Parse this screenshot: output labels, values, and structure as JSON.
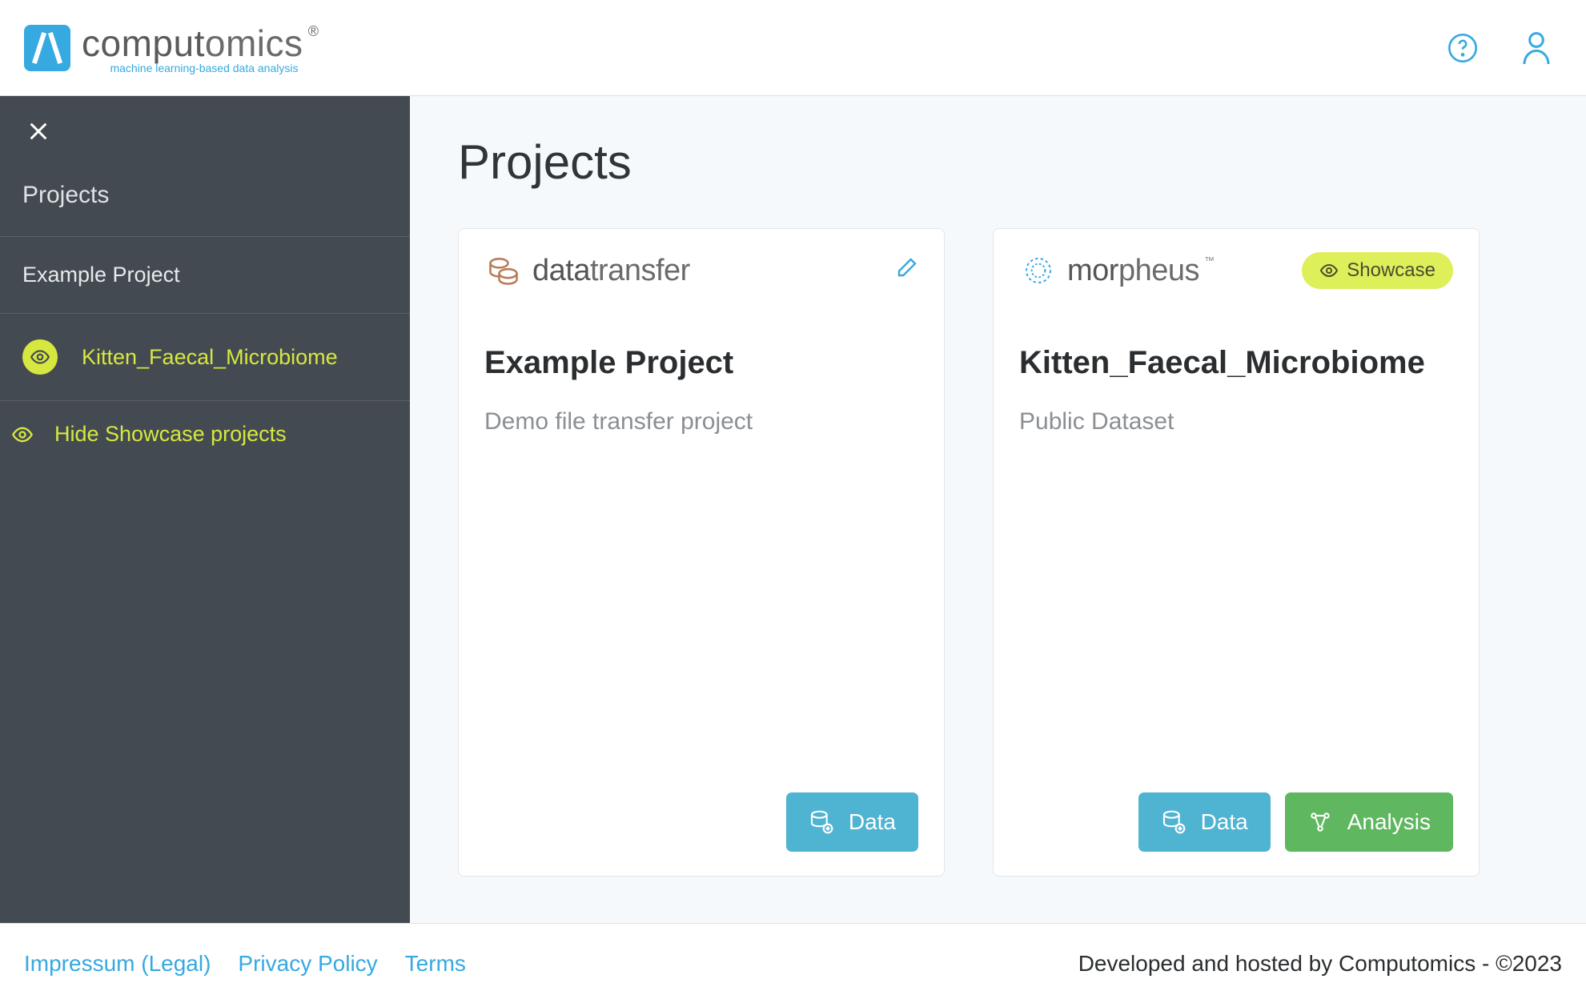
{
  "header": {
    "brand_main": "comput",
    "brand_suffix": "omics",
    "brand_reg": "®",
    "brand_tagline": "machine learning-based data analysis"
  },
  "sidebar": {
    "section_title": "Projects",
    "items": [
      {
        "label": "Example Project",
        "active": false
      },
      {
        "label": "Kitten_Faecal_Microbiome",
        "active": true
      }
    ],
    "toggle_label": "Hide Showcase projects"
  },
  "main": {
    "title": "Projects",
    "cards": [
      {
        "brand_bold": "data",
        "brand_light": "transfer",
        "showcase": false,
        "title": "Example Project",
        "desc": "Demo file transfer project",
        "data_btn": "Data",
        "analysis_btn": null
      },
      {
        "brand_bold": "mor",
        "brand_light": "pheus",
        "brand_tm": "™",
        "showcase": true,
        "showcase_label": "Showcase",
        "title": "Kitten_Faecal_Microbiome",
        "desc": "Public Dataset",
        "data_btn": "Data",
        "analysis_btn": "Analysis"
      }
    ]
  },
  "footer": {
    "links": [
      "Impressum (Legal)",
      "Privacy Policy",
      "Terms"
    ],
    "right": "Developed and hosted by Computomics - ©2023"
  }
}
